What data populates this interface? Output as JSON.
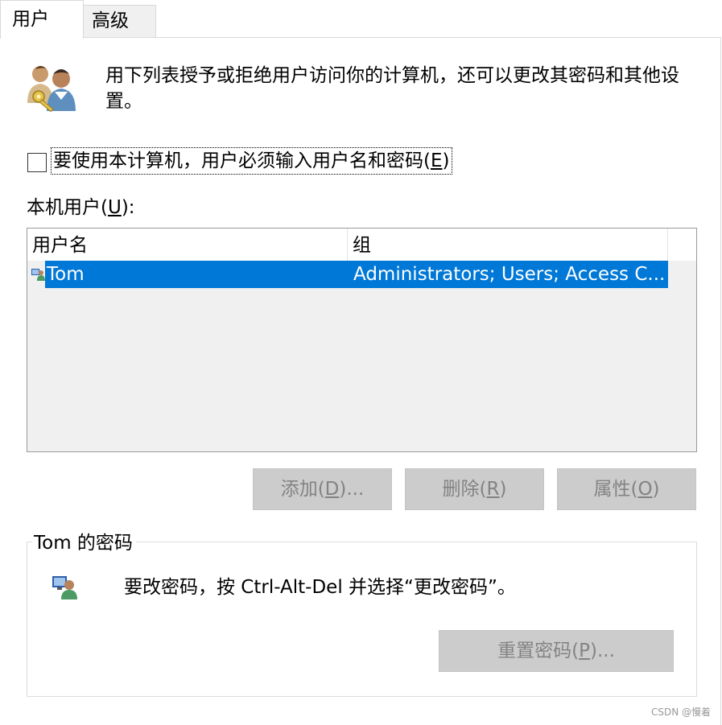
{
  "tabs": {
    "users": "用户",
    "advanced": "高级"
  },
  "description": "用下列表授予或拒绝用户访问你的计算机，还可以更改其密码和其他设置。",
  "require_login": {
    "checked": false,
    "label_before": "要使用本计算机，用户必须输入用户名和密码(",
    "label_key": "E",
    "label_after": ")"
  },
  "users_section": {
    "label_before": "本机用户(",
    "label_key": "U",
    "label_after": "):"
  },
  "table": {
    "columns": [
      "用户名",
      "组"
    ],
    "rows": [
      {
        "name": "Tom",
        "groups": "Administrators; Users; Access C...",
        "selected": true,
        "icon": "user-icon"
      }
    ]
  },
  "buttons": {
    "add": {
      "before": "添加(",
      "key": "D",
      "after": ")..."
    },
    "remove": {
      "before": "删除(",
      "key": "R",
      "after": ")"
    },
    "properties": {
      "before": "属性(",
      "key": "O",
      "after": ")"
    }
  },
  "password_group": {
    "title": "Tom 的密码",
    "message": "要改密码，按 Ctrl-Alt-Del 并选择“更改密码”。",
    "reset": {
      "before": "重置密码(",
      "key": "P",
      "after": ")..."
    }
  },
  "watermark": "CSDN @慢着",
  "colors": {
    "selection": "#0078d7",
    "disabled_button": "#cccccc",
    "disabled_text": "#838383"
  }
}
